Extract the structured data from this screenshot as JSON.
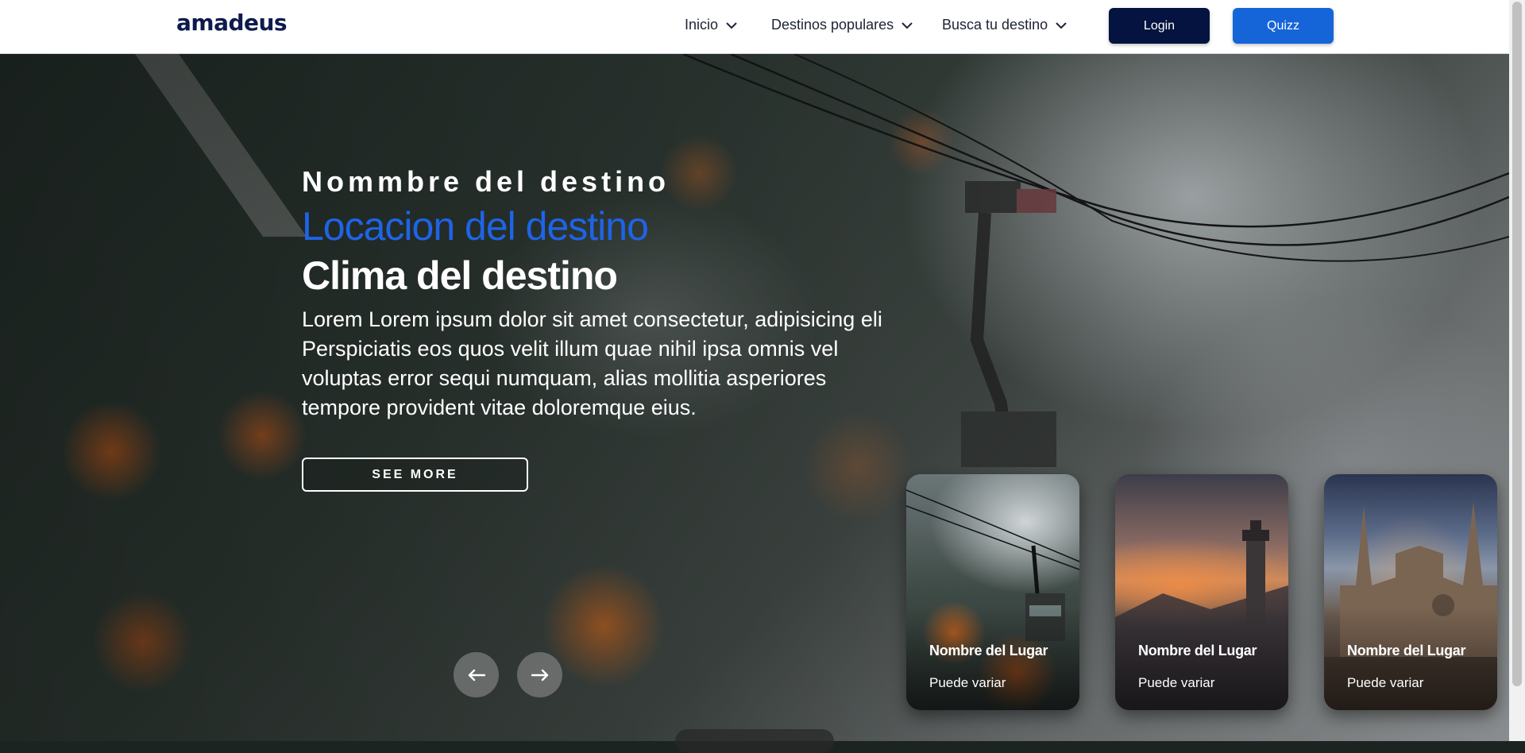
{
  "brand": {
    "logo_text": "amadeus"
  },
  "nav": {
    "items": [
      {
        "label": "Inicio"
      },
      {
        "label": "Destinos populares"
      },
      {
        "label": "Busca tu destino"
      }
    ],
    "login_label": "Login",
    "quizz_label": "Quizz"
  },
  "hero": {
    "name": "Nommbre del destino",
    "location": "Locacion del destino",
    "weather": "Clima del destino",
    "description": "Lorem Lorem ipsum dolor sit amet consectetur, adipisicing eli Perspiciatis eos quos velit illum quae nihil ipsa omnis vel voluptas error sequi numquam, alias mollitia asperiores tempore provident vitae doloremque eius.",
    "see_more_label": "SEE MORE"
  },
  "cards": [
    {
      "title": "Nombre del Lugar",
      "subtitle": "Puede variar"
    },
    {
      "title": "Nombre del Lugar",
      "subtitle": "Puede variar"
    },
    {
      "title": "Nombre del Lugar",
      "subtitle": "Puede variar"
    }
  ],
  "icons": {
    "nav_chevron": "chevron-down-icon",
    "prev": "arrow-left-icon",
    "next": "arrow-right-icon"
  },
  "colors": {
    "brand_navy": "#0d1a4d",
    "login_bg": "#04133f",
    "quizz_bg": "#1565d8",
    "location_accent": "#1e64e6"
  }
}
